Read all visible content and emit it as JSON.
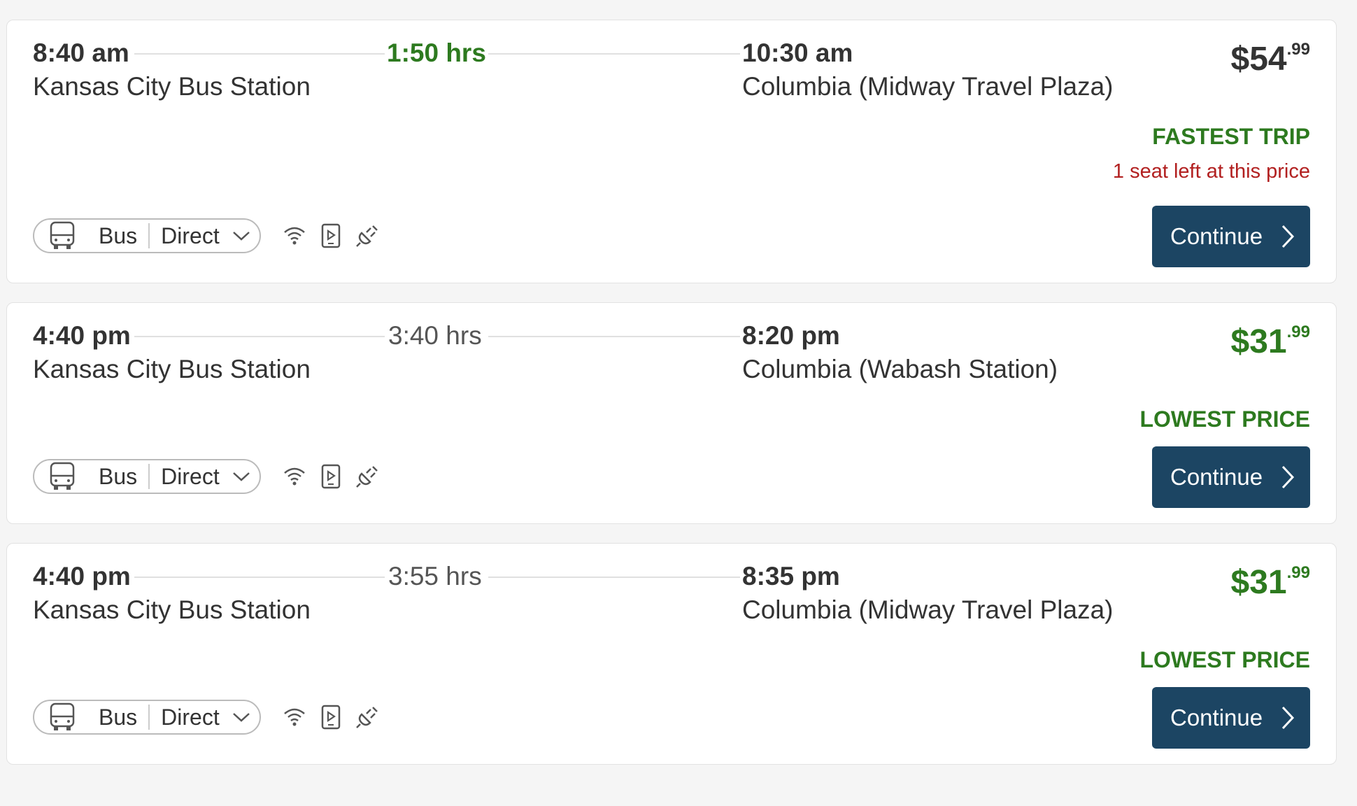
{
  "trips": [
    {
      "depart_time": "8:40 am",
      "depart_station": "Kansas City Bus Station",
      "duration": "1:50 hrs",
      "arrive_time": "10:30 am",
      "arrive_station": "Columbia (Midway Travel Plaza)",
      "price_dollars": "$54",
      "price_cents": ".99",
      "badge": "FASTEST TRIP",
      "seats_note": "1 seat left at this price",
      "mode": "Bus",
      "route_type": "Direct",
      "continue_label": "Continue"
    },
    {
      "depart_time": "4:40 pm",
      "depart_station": "Kansas City Bus Station",
      "duration": "3:40 hrs",
      "arrive_time": "8:20 pm",
      "arrive_station": "Columbia (Wabash Station)",
      "price_dollars": "$31",
      "price_cents": ".99",
      "badge": "LOWEST PRICE",
      "mode": "Bus",
      "route_type": "Direct",
      "continue_label": "Continue"
    },
    {
      "depart_time": "4:40 pm",
      "depart_station": "Kansas City Bus Station",
      "duration": "3:55 hrs",
      "arrive_time": "8:35 pm",
      "arrive_station": "Columbia (Midway Travel Plaza)",
      "price_dollars": "$31",
      "price_cents": ".99",
      "badge": "LOWEST PRICE",
      "mode": "Bus",
      "route_type": "Direct",
      "continue_label": "Continue"
    }
  ],
  "amenity_icons": [
    "wifi-icon",
    "entertainment-icon",
    "power-outlet-icon"
  ],
  "mode_icon": "bus-icon",
  "colors": {
    "accent_green": "#2d7a1f",
    "warning_red": "#b22020",
    "button_navy": "#1c4563",
    "text_dark": "#333333"
  }
}
